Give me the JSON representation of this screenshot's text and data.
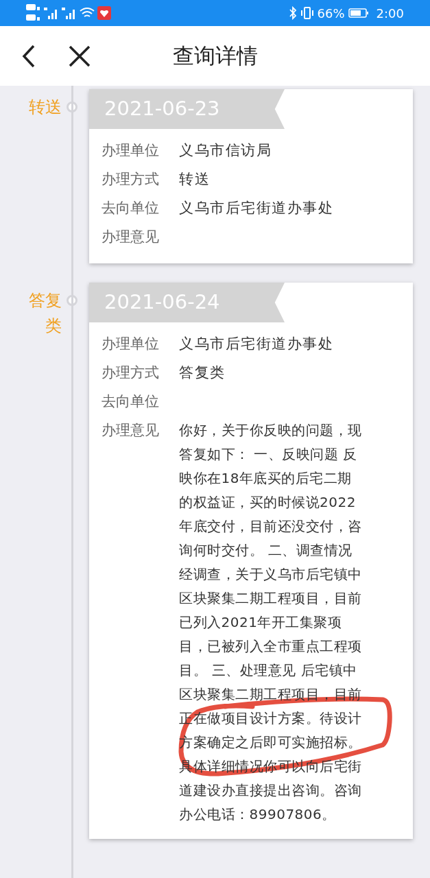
{
  "status_bar": {
    "battery": "66%",
    "time": "2:00"
  },
  "header": {
    "title": "查询详情"
  },
  "timeline": [
    {
      "label": "转送",
      "date": "2021-06-23",
      "fields": [
        {
          "label": "办理单位",
          "value": "义乌市信访局"
        },
        {
          "label": "办理方式",
          "value": "转送"
        },
        {
          "label": "去向单位",
          "value": "义乌市后宅街道办事处"
        },
        {
          "label": "办理意见"
        }
      ]
    },
    {
      "label": "答复类",
      "date": "2021-06-24",
      "fields": [
        {
          "label": "办理单位",
          "value": "义乌市后宅街道办事处"
        },
        {
          "label": "办理方式",
          "value": "答复类"
        },
        {
          "label": "去向单位"
        },
        {
          "label": "办理意见",
          "lines": [
            "你好，关于你反映的问题，现",
            "答复如下： 一、反映问题 反",
            "映你在18年底买的后宅二期",
            "的权益证，买的时候说2022",
            "年底交付，目前还没交付，咨",
            "询何时交付。 二、调查情况",
            "经调查，关于义乌市后宅镇中",
            "区块聚集二期工程项目，目前",
            "已列入2021年开工集聚项",
            "目，已被列入全市重点工程项",
            "目。 三、处理意见 后宅镇中",
            "区块聚集二期工程项目，目前",
            "正在做项目设计方案。待设计",
            "方案确定之后即可实施招标。",
            "具体详细情况你可以向后宅街",
            "道建设办直接提出咨询。咨询",
            "办公电话：89907806。"
          ]
        }
      ]
    }
  ]
}
